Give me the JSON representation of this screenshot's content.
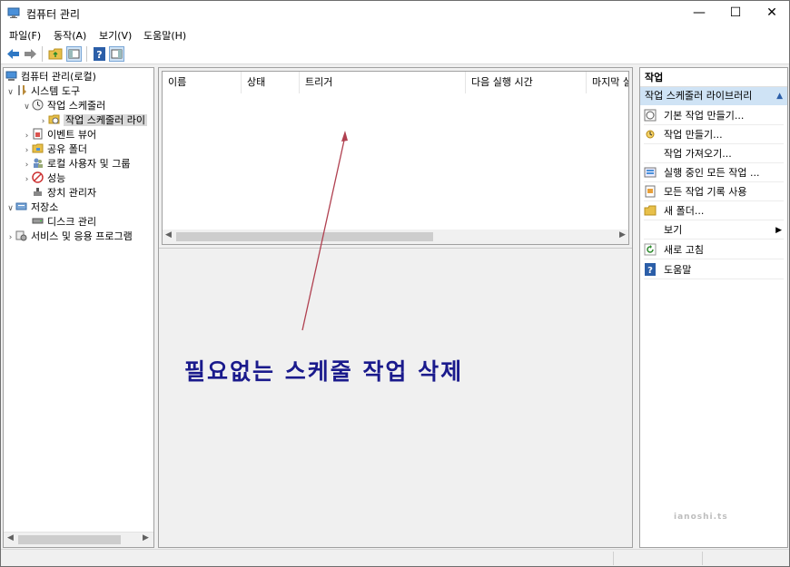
{
  "window": {
    "title": "컴퓨터 관리"
  },
  "menu": [
    "파일(F)",
    "동작(A)",
    "보기(V)",
    "도움말(H)"
  ],
  "tree": {
    "root": "컴퓨터 관리(로컬)",
    "system_tools": "시스템 도구",
    "task_scheduler": "작업 스케줄러",
    "task_scheduler_library": "작업 스케줄러 라이",
    "event_viewer": "이벤트 뷰어",
    "shared_folders": "공유 폴더",
    "local_users": "로컬 사용자 및 그룹",
    "performance": "성능",
    "device_manager": "장치 관리자",
    "storage": "저장소",
    "disk_management": "디스크 관리",
    "services": "서비스 및 응용 프로그램"
  },
  "list": {
    "columns": [
      "이름",
      "상태",
      "트리거",
      "다음 실행 시간",
      "마지막 실"
    ]
  },
  "actions": {
    "header": "작업",
    "section": "작업 스케줄러 라이브러리",
    "items": [
      {
        "label": "기본 작업 만들기...",
        "icon": "basic-task-icon"
      },
      {
        "label": "작업 만들기...",
        "icon": "create-task-icon"
      },
      {
        "label": "작업 가져오기...",
        "icon": ""
      },
      {
        "label": "실행 중인 모든 작업 ...",
        "icon": "running-tasks-icon"
      },
      {
        "label": "모든 작업 기록 사용",
        "icon": "history-icon"
      },
      {
        "label": "새 폴더...",
        "icon": "folder-icon"
      },
      {
        "label": "보기",
        "icon": ""
      },
      {
        "label": "새로 고침",
        "icon": "refresh-icon"
      },
      {
        "label": "도움말",
        "icon": "help-icon"
      }
    ]
  },
  "annotation": "필요없는 스케줄 작업 삭제",
  "watermark": "ianoshi.ts"
}
